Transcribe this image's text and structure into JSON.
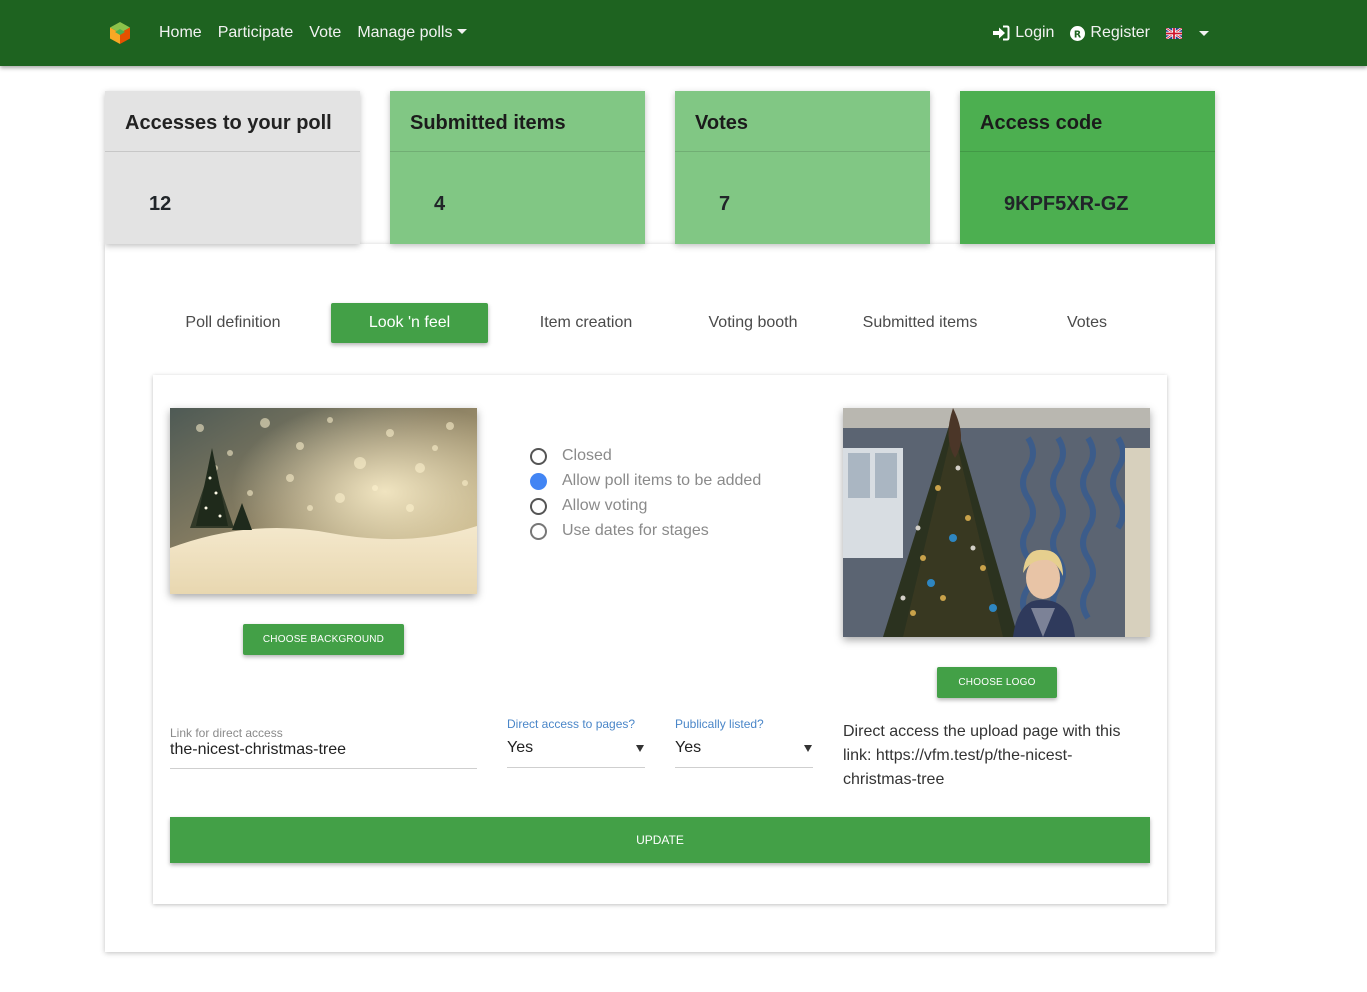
{
  "nav": {
    "logo_icon": "cube-logo-icon",
    "links": [
      "Home",
      "Participate",
      "Vote",
      "Manage polls"
    ],
    "login": "Login",
    "register": "Register",
    "login_icon": "sign-in-icon",
    "register_icon": "registered-icon",
    "language_icon": "uk-flag-icon",
    "colors": {
      "navbar_bg": "#1e6320"
    }
  },
  "stats": [
    {
      "title": "Accesses to your poll",
      "value": "12"
    },
    {
      "title": "Submitted items",
      "value": "4"
    },
    {
      "title": "Votes",
      "value": "7"
    },
    {
      "title": "Access code",
      "value": "9KPF5XR-GZ"
    }
  ],
  "tabs": [
    "Poll definition",
    "Look 'n feel",
    "Item creation",
    "Voting booth",
    "Submitted items",
    "Votes"
  ],
  "active_tab": "Look 'n feel",
  "look": {
    "choose_background": "CHOOSE BACKGROUND",
    "choose_logo": "CHOOSE LOGO",
    "background_image": "snowy-christmas-tree-bokeh-image",
    "logo_image": "woman-beside-christmas-tree-photo",
    "stages": [
      {
        "label": "Closed",
        "checked": false
      },
      {
        "label": "Allow poll items to be added",
        "checked": true
      },
      {
        "label": "Allow voting",
        "checked": false
      },
      {
        "label": "Use dates for stages",
        "checked": false
      }
    ],
    "link_label": "Link for direct access",
    "link_value": "the-nicest-christmas-tree",
    "direct_access_label": "Direct access to pages?",
    "direct_access_value": "Yes",
    "public_label": "Publically listed?",
    "public_value": "Yes",
    "direct_text": "Direct access the upload page with this link: https://vfm.test/p/the-nicest-christmas-tree",
    "update": "UPDATE",
    "colors": {
      "accent": "#43a047",
      "focus_label": "#4a86c8"
    }
  }
}
